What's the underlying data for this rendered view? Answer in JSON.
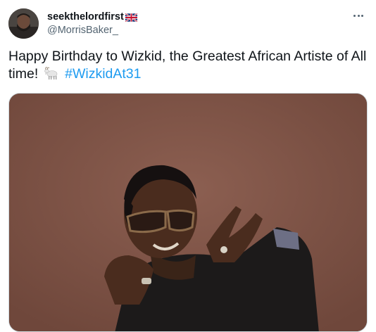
{
  "tweet": {
    "display_name": "seekthelordfirst",
    "handle": "@MorrisBaker_",
    "text_main": "Happy Birthday to Wizkid, the Greatest African Artiste of All time!",
    "hashtag": "#WizkidAt31",
    "emoji_icon": "goat-icon",
    "flag_icon": "uk-flag-icon",
    "more_icon": "more-options-icon"
  },
  "colors": {
    "hashtag": "#1d9bf0",
    "text": "#0f1419",
    "secondary": "#536471",
    "media_background": "#8a5b4e"
  }
}
